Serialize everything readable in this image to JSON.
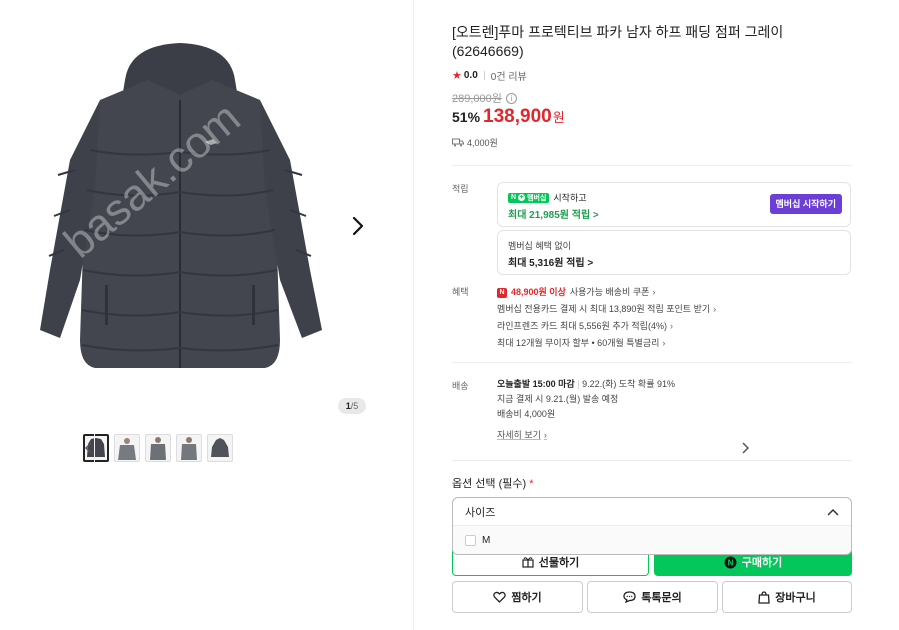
{
  "gallery": {
    "watermark": "basak.com",
    "counter_current": "1",
    "counter_total": "/5"
  },
  "product": {
    "title": "[오트렌]푸마 프로텍티브 파카 남자 하프 패딩 점퍼 그레이 (62646669)",
    "rating": "0.0",
    "review_count": "0건 리뷰",
    "original_price": "289,000원",
    "discount": "51%",
    "sale_price": "138,900",
    "won": "원",
    "shipping_fee": "4,000원"
  },
  "points": {
    "label": "적립",
    "badge_n": "N",
    "badge_text": "멤버십",
    "start_text": "시작하고",
    "max_with_membership": "최대 21,985원 적립 >",
    "member_button": "멤버십 시작하기",
    "no_membership": "멤버십 혜택 없이",
    "max_without": "최대 5,316원 적립 >"
  },
  "benefits": {
    "label": "혜택",
    "coupon_amount": "48,900원 이상",
    "coupon_text": "사용가능 배송비 쿠폰",
    "items": [
      "멤버십 전용카드 결제 시 최대 13,890원 적립 포인트 받기",
      "라인프렌즈 카드 최대 5,556원 추가 적립(4%)",
      "최대 12개월 무이자 할부 • 60개월 특별금리"
    ]
  },
  "delivery": {
    "label": "배송",
    "today": "오늘출발 15:00 마감",
    "arrival": "9.22.(화) 도착 확률 91%",
    "dispatch": "지금 결제 시 9.21.(월) 발송 예정",
    "fee": "배송비 4,000원",
    "detail_link": "자세히 보기"
  },
  "options": {
    "label": "옵션 선택 (필수)",
    "required_mark": "*",
    "dropdown_head": "사이즈",
    "option_m": "M"
  },
  "actions": {
    "gift": "선물하기",
    "buy": "구매하기",
    "wish": "찜하기",
    "talk": "톡톡문의",
    "cart": "장바구니"
  },
  "colors": {
    "accent_red": "#e4262b",
    "naver_green": "#03c75a",
    "membership_purple": "#6b3ed6"
  }
}
